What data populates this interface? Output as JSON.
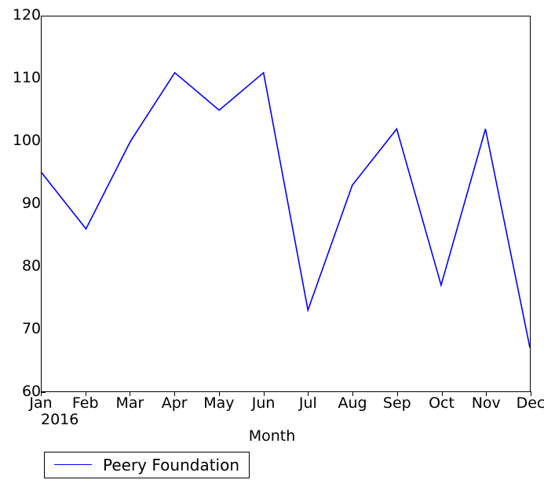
{
  "chart_data": {
    "type": "line",
    "title": "",
    "xlabel": "Month",
    "ylabel": "",
    "categories": [
      "Jan",
      "Feb",
      "Mar",
      "Apr",
      "May",
      "Jun",
      "Jul",
      "Aug",
      "Sep",
      "Oct",
      "Nov",
      "Dec"
    ],
    "x_year_label": "2016",
    "ylim": [
      60,
      120
    ],
    "yticks": [
      60,
      70,
      80,
      90,
      100,
      110,
      120
    ],
    "grid": false,
    "legend_position": "below-left",
    "series": [
      {
        "name": "Peery Foundation",
        "color": "#0000ff",
        "values": [
          95,
          86,
          100,
          111,
          105,
          111,
          73,
          93,
          102,
          77,
          102,
          67
        ]
      }
    ]
  },
  "legend": {
    "entries": [
      {
        "label": "Peery Foundation",
        "color": "#0000ff"
      }
    ]
  },
  "axes": {
    "x_title": "Month",
    "y_tick_labels": [
      "60",
      "70",
      "80",
      "90",
      "100",
      "110",
      "120"
    ],
    "x_tick_labels": [
      "Jan",
      "Feb",
      "Mar",
      "Apr",
      "May",
      "Jun",
      "Jul",
      "Aug",
      "Sep",
      "Oct",
      "Nov",
      "Dec"
    ],
    "x_year": "2016"
  }
}
